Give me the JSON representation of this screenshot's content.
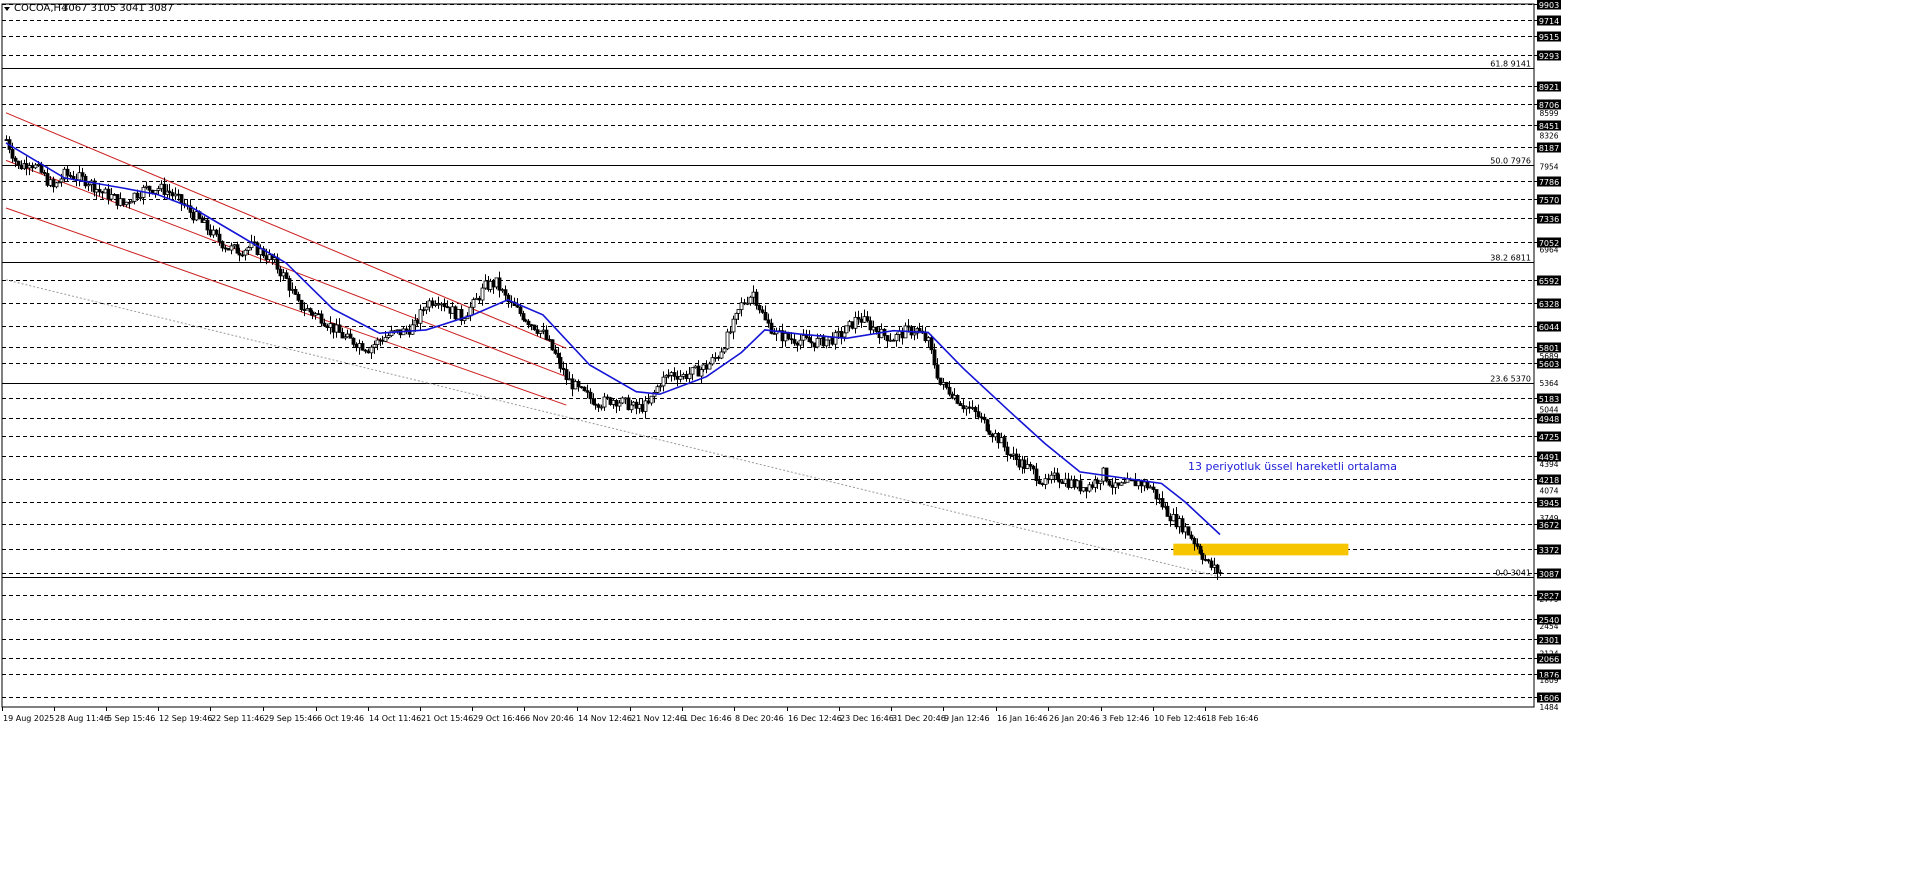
{
  "header": {
    "symbol_label": "COCOA,H4",
    "ohlc_label": "3067 3105 3041 3087"
  },
  "colors": {
    "ema_line": "#1515d6",
    "channel_line": "#cc1f1f",
    "highlight_box": "#f7c400",
    "annotation_text": "#1c1cd8",
    "candle": "#000000",
    "trendline": "#9a9a9a"
  },
  "chart_data": {
    "type": "candlestick",
    "symbol": "COCOA",
    "timeframe": "H4",
    "ylim": [
      1484,
      9903
    ],
    "grid": "horizontal dashed at price levels",
    "y_tick_labels": [
      "9903",
      "9714",
      "9515",
      "9293",
      "8921",
      "8706",
      "8599",
      "8451",
      "8326",
      "8187",
      "7954",
      "7786",
      "7570",
      "7336",
      "7052",
      "6964",
      "6592",
      "6328",
      "6044",
      "5801",
      "5689",
      "5603",
      "5364",
      "5183",
      "5044",
      "4948",
      "4725",
      "4491",
      "4394",
      "4218",
      "4074",
      "3945",
      "3749",
      "3672",
      "3372",
      "3087",
      "2827",
      "2779",
      "2540",
      "2454",
      "2301",
      "2124",
      "2066",
      "1876",
      "1809",
      "1606",
      "1484"
    ],
    "boxed_y_labels": [
      "9903",
      "9714",
      "9515",
      "9293",
      "8921",
      "8706",
      "8451",
      "8187",
      "7786",
      "7570",
      "7336",
      "7052",
      "6592",
      "6328",
      "6044",
      "5801",
      "5603",
      "5183",
      "4948",
      "4725",
      "4491",
      "4218",
      "3945",
      "3672",
      "3372",
      "3087",
      "2827",
      "2540",
      "2301",
      "2066",
      "1876",
      "1606"
    ],
    "x_tick_labels": [
      "19 Aug 2025",
      "28 Aug 11:46",
      "5 Sep 15:46",
      "12 Sep 19:46",
      "22 Sep 11:46",
      "29 Sep 15:46",
      "6 Oct 19:46",
      "14 Oct 11:46",
      "21 Oct 15:46",
      "29 Oct 16:46",
      "6 Nov 20:46",
      "14 Nov 12:46",
      "21 Nov 12:46",
      "1 Dec 16:46",
      "8 Dec 20:46",
      "16 Dec 12:46",
      "23 Dec 16:46",
      "31 Dec 20:46",
      "9 Jan 12:46",
      "16 Jan 16:46",
      "26 Jan 20:46",
      "3 Feb 12:46",
      "10 Feb 12:46",
      "18 Feb 16:46"
    ],
    "close_path": [
      [
        0,
        8280
      ],
      [
        1,
        7950
      ],
      [
        2,
        8020
      ],
      [
        3,
        7880
      ],
      [
        4,
        7700
      ],
      [
        5,
        7860
      ],
      [
        6,
        7830
      ],
      [
        7,
        7780
      ],
      [
        8,
        7660
      ],
      [
        9,
        7600
      ],
      [
        10,
        7500
      ],
      [
        11,
        7620
      ],
      [
        12,
        7690
      ],
      [
        13,
        7700
      ],
      [
        14,
        7650
      ],
      [
        15,
        7520
      ],
      [
        16,
        7380
      ],
      [
        17,
        7250
      ],
      [
        18,
        7100
      ],
      [
        19,
        6980
      ],
      [
        20,
        6950
      ],
      [
        21,
        7000
      ],
      [
        22,
        6920
      ],
      [
        23,
        6800
      ],
      [
        24,
        6600
      ],
      [
        25,
        6300
      ],
      [
        26,
        6220
      ],
      [
        27,
        6150
      ],
      [
        28,
        6020
      ],
      [
        29,
        5900
      ],
      [
        30,
        5850
      ],
      [
        31,
        5780
      ],
      [
        32,
        5880
      ],
      [
        33,
        5950
      ],
      [
        34,
        5980
      ],
      [
        35,
        6050
      ],
      [
        36,
        6320
      ],
      [
        37,
        6380
      ],
      [
        38,
        6250
      ],
      [
        39,
        6150
      ],
      [
        40,
        6300
      ],
      [
        41,
        6520
      ],
      [
        42,
        6560
      ],
      [
        43,
        6330
      ],
      [
        44,
        6200
      ],
      [
        45,
        6080
      ],
      [
        46,
        5950
      ],
      [
        47,
        5700
      ],
      [
        48,
        5420
      ],
      [
        49,
        5280
      ],
      [
        50,
        5180
      ],
      [
        51,
        5130
      ],
      [
        52,
        5170
      ],
      [
        53,
        5120
      ],
      [
        54,
        5060
      ],
      [
        55,
        5100
      ],
      [
        56,
        5380
      ],
      [
        57,
        5480
      ],
      [
        58,
        5450
      ],
      [
        59,
        5500
      ],
      [
        60,
        5560
      ],
      [
        61,
        5700
      ],
      [
        62,
        5980
      ],
      [
        63,
        6300
      ],
      [
        64,
        6450
      ],
      [
        65,
        6100
      ],
      [
        66,
        5950
      ],
      [
        67,
        5900
      ],
      [
        68,
        5880
      ],
      [
        69,
        5850
      ],
      [
        70,
        5870
      ],
      [
        71,
        5900
      ],
      [
        72,
        6000
      ],
      [
        73,
        6150
      ],
      [
        74,
        6050
      ],
      [
        75,
        5950
      ],
      [
        76,
        5900
      ],
      [
        77,
        5980
      ],
      [
        78,
        6000
      ],
      [
        79,
        5850
      ],
      [
        80,
        5350
      ],
      [
        81,
        5250
      ],
      [
        82,
        5100
      ],
      [
        83,
        5000
      ],
      [
        84,
        4850
      ],
      [
        85,
        4700
      ],
      [
        86,
        4500
      ],
      [
        87,
        4400
      ],
      [
        88,
        4300
      ],
      [
        89,
        4150
      ],
      [
        90,
        4250
      ],
      [
        91,
        4180
      ],
      [
        92,
        4120
      ],
      [
        93,
        4150
      ],
      [
        94,
        4280
      ],
      [
        95,
        4100
      ],
      [
        96,
        4150
      ],
      [
        97,
        4180
      ],
      [
        98,
        4120
      ],
      [
        99,
        3900
      ],
      [
        100,
        3740
      ],
      [
        101,
        3620
      ],
      [
        102,
        3420
      ],
      [
        103,
        3190
      ],
      [
        104,
        3087
      ]
    ],
    "ema_period": 13,
    "ema_path": [
      [
        0,
        8240
      ],
      [
        5,
        7820
      ],
      [
        10,
        7700
      ],
      [
        13,
        7620
      ],
      [
        16,
        7460
      ],
      [
        20,
        7130
      ],
      [
        24,
        6800
      ],
      [
        28,
        6250
      ],
      [
        32,
        5960
      ],
      [
        36,
        6000
      ],
      [
        40,
        6180
      ],
      [
        43,
        6360
      ],
      [
        46,
        6180
      ],
      [
        50,
        5580
      ],
      [
        54,
        5260
      ],
      [
        56,
        5230
      ],
      [
        60,
        5440
      ],
      [
        63,
        5730
      ],
      [
        65,
        6000
      ],
      [
        68,
        5950
      ],
      [
        72,
        5900
      ],
      [
        76,
        5990
      ],
      [
        79,
        5970
      ],
      [
        82,
        5540
      ],
      [
        86,
        5020
      ],
      [
        89,
        4640
      ],
      [
        92,
        4300
      ],
      [
        96,
        4220
      ],
      [
        99,
        4160
      ],
      [
        101,
        3940
      ],
      [
        104,
        3550
      ]
    ],
    "fibonacci": {
      "levels": [
        {
          "label": "61.8",
          "value": 9141,
          "text": "61.8 9141"
        },
        {
          "label": "50.0",
          "value": 7976,
          "text": "50.0 7976"
        },
        {
          "label": "38.2",
          "value": 6811,
          "text": "38.2 6811"
        },
        {
          "label": "23.6",
          "value": 5370,
          "text": "23.6 5370"
        },
        {
          "label": "0.0",
          "value": 3041,
          "text": "0.0 3041"
        }
      ]
    },
    "annotations": [
      {
        "text": "13 periyotluk üssel hareketli ortalama"
      }
    ],
    "channel": {
      "upper": [
        [
          0,
          8600
        ],
        [
          48,
          5780
        ]
      ],
      "lower": [
        [
          0,
          7460
        ],
        [
          48,
          5100
        ]
      ]
    },
    "trendline": [
      [
        0,
        6600
      ],
      [
        104,
        3041
      ]
    ],
    "highlight_zone": {
      "x_from": 100,
      "x_to": 115,
      "y_from": 3300,
      "y_to": 3440
    }
  }
}
